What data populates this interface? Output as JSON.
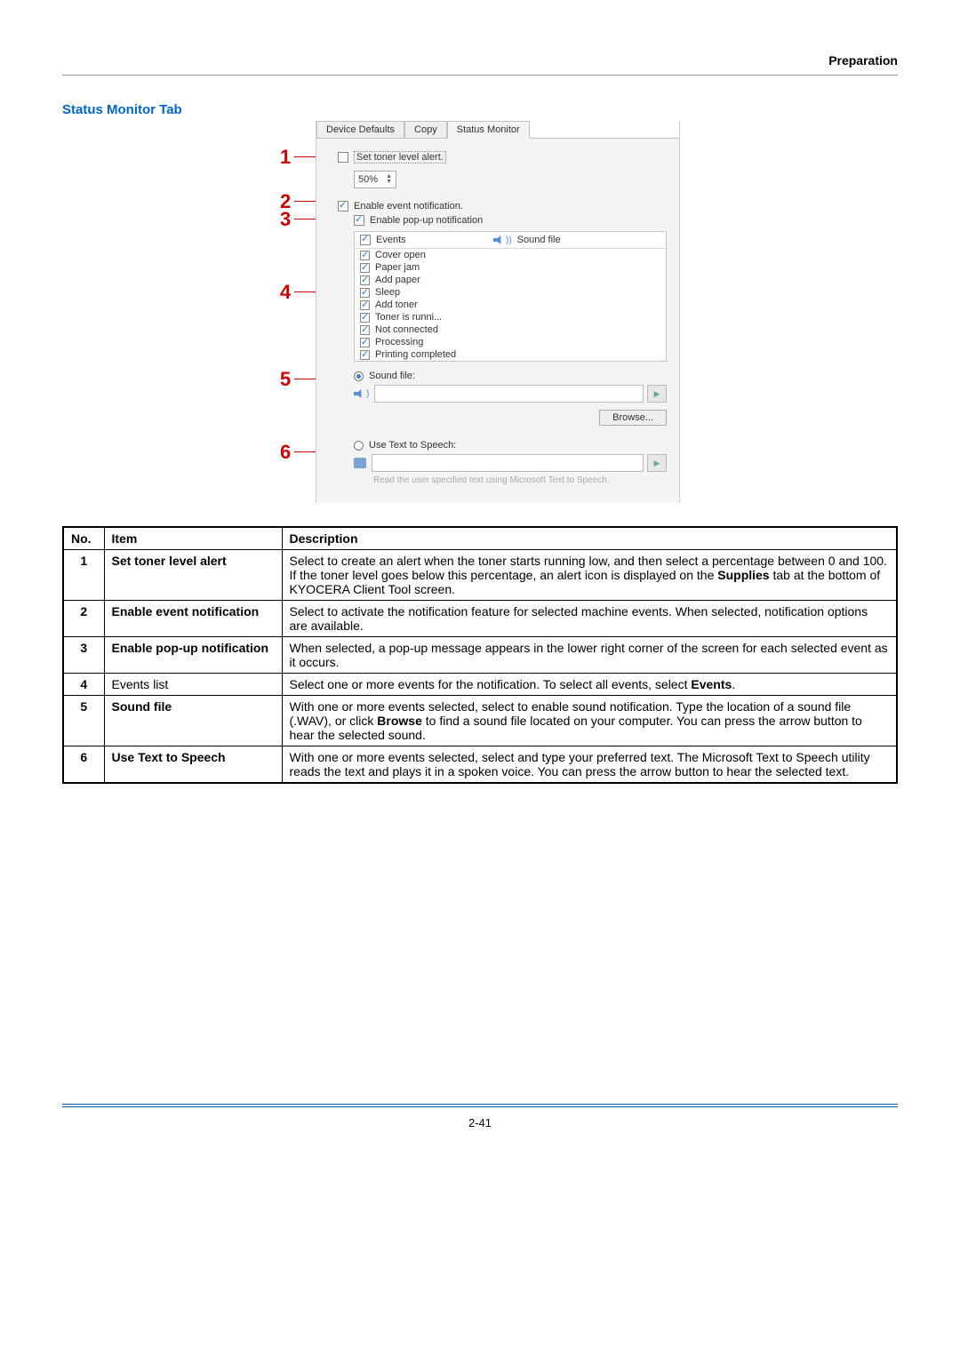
{
  "header": {
    "category": "Preparation"
  },
  "section": {
    "title": "Status Monitor Tab"
  },
  "callouts": [
    "1",
    "2",
    "3",
    "4",
    "5",
    "6"
  ],
  "dialog": {
    "tabs": [
      "Device Defaults",
      "Copy",
      "Status Monitor"
    ],
    "active_tab": "Status Monitor",
    "set_toner_label": "Set toner level alert.",
    "spinner_value": "50%",
    "enable_event_label": "Enable event notification.",
    "enable_popup_label": "Enable pop-up notification",
    "events_header_events": "Events",
    "events_header_sound": "Sound file",
    "events": [
      "Cover open",
      "Paper jam",
      "Add paper",
      "Sleep",
      "Add toner",
      "Toner is runni...",
      "Not connected",
      "Processing",
      "Printing completed"
    ],
    "sound_file_label": "Sound file:",
    "browse_label": "Browse...",
    "tts_label": "Use Text to Speech:",
    "tts_desc": "Read the user specified text using Microsoft Text to Speech."
  },
  "table": {
    "head_no": "No.",
    "head_item": "Item",
    "head_desc": "Description",
    "rows": [
      {
        "no": "1",
        "item": "Set toner level alert",
        "item_bold": true,
        "desc_pre": "Select to create an alert when the toner starts running low, and then select a percentage between 0 and 100. If the toner level goes below this percentage, an alert icon is displayed on the ",
        "desc_bold": "Supplies",
        "desc_post": " tab at the bottom of KYOCERA Client Tool screen."
      },
      {
        "no": "2",
        "item": "Enable event notification",
        "item_bold": true,
        "desc_pre": "Select to activate the notification feature for selected machine events. When selected, notification options are available.",
        "desc_bold": "",
        "desc_post": ""
      },
      {
        "no": "3",
        "item": "Enable pop-up notification",
        "item_bold": true,
        "desc_pre": "When selected, a pop-up message appears in the lower right corner of the screen for each selected event as it occurs.",
        "desc_bold": "",
        "desc_post": ""
      },
      {
        "no": "4",
        "item": "Events list",
        "item_bold": false,
        "desc_pre": "Select one or more events for the notification. To select all events, select ",
        "desc_bold": "Events",
        "desc_post": "."
      },
      {
        "no": "5",
        "item": "Sound file",
        "item_bold": true,
        "desc_pre": "With one or more events selected, select to enable sound notification. Type the location of a sound file (.WAV), or click ",
        "desc_bold": "Browse",
        "desc_post": " to find a sound file located on your computer. You can press the arrow button to hear the selected sound."
      },
      {
        "no": "6",
        "item": "Use Text to Speech",
        "item_bold": true,
        "desc_pre": "With one or more events selected, select and type your preferred text. The Microsoft Text to Speech utility reads the text and plays it in a spoken voice. You can press the arrow button to hear the selected text.",
        "desc_bold": "",
        "desc_post": ""
      }
    ]
  },
  "footer": {
    "page": "2-41"
  }
}
